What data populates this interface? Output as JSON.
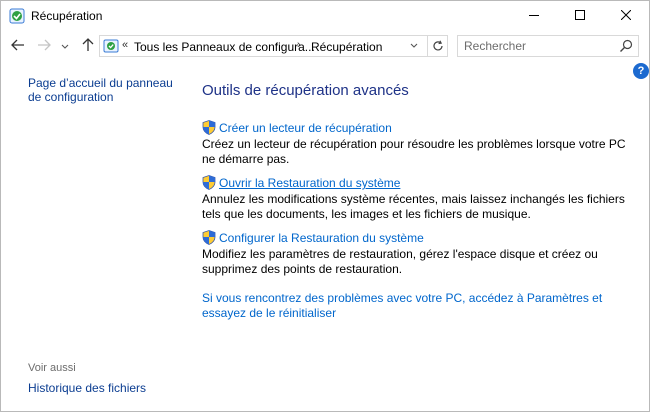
{
  "window": {
    "title": "Récupération",
    "icon": "recovery-control-panel-icon"
  },
  "navigation": {
    "breadcrumb_prefix": "«",
    "breadcrumb_root": "Tous les Panneaux de configura...",
    "breadcrumb_separator": "›",
    "breadcrumb_current": "Récupération",
    "search_placeholder": "Rechercher"
  },
  "left_pane": {
    "home_link": "Page d’accueil du panneau de configuration",
    "see_also_label": "Voir aussi",
    "see_also_items": [
      "Historique des fichiers"
    ]
  },
  "main": {
    "title": "Outils de récupération avancés",
    "tasks": [
      {
        "label": "Créer un lecteur de récupération",
        "description": "Créez un lecteur de récupération pour résoudre les problèmes lorsque votre PC ne démarre pas.",
        "icon": "uac-shield-icon"
      },
      {
        "label": "Ouvrir la Restauration du système",
        "description": "Annulez les modifications système récentes, mais laissez inchangés les fichiers tels que les documents, les images et les fichiers de musique.",
        "icon": "uac-shield-icon",
        "hovered": true
      },
      {
        "label": "Configurer la Restauration du système",
        "description": "Modifiez les paramètres de restauration, gérez l'espace disque et créez ou supprimez des points de restauration.",
        "icon": "uac-shield-icon"
      }
    ],
    "reset_link": "Si vous rencontrez des problèmes avec votre PC, accédez à Paramètres et essayez de le réinitialiser"
  },
  "colors": {
    "link": "#0066cc",
    "title": "#1e3287",
    "nav_link": "#0b3d91",
    "help": "#1c6ad0"
  }
}
